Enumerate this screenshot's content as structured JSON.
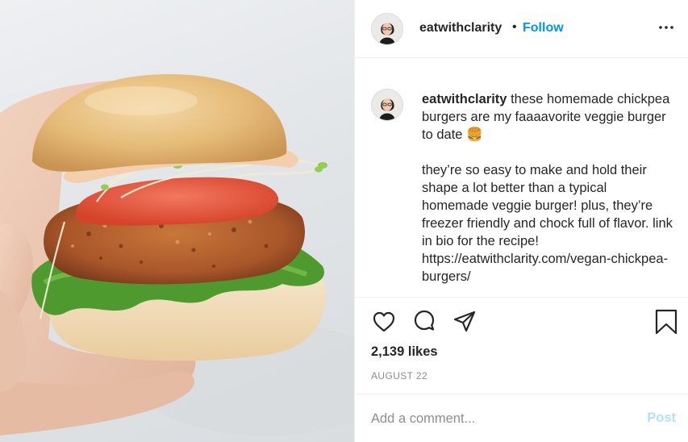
{
  "post": {
    "image": {
      "subject": "burger-photo"
    },
    "header": {
      "username": "eatwithclarity",
      "separator": "•",
      "follow_label": "Follow",
      "more_icon": "more-options-icon"
    },
    "caption": {
      "username": "eatwithclarity",
      "text_line1": "these homemade chickpea burgers are my faaaavorite veggie burger to date 🍔",
      "text_line2": "they’re so easy to make and hold their shape a lot better than a typical homemade veggie burger! plus, they’re freezer friendly and chock full of flavor. link in bio for the recipe! https://eatwithclarity.com/vegan-chickpea-burgers/"
    },
    "actions": {
      "like_icon": "heart-icon",
      "comment_icon": "comment-icon",
      "share_icon": "share-icon",
      "save_icon": "bookmark-icon"
    },
    "likes": "2,139 likes",
    "date": "AUGUST 22",
    "comment_box": {
      "placeholder": "Add a comment...",
      "post_label": "Post"
    },
    "colors": {
      "link_blue": "#0095f6",
      "post_disabled": "#b2dffc",
      "text": "#262626",
      "muted": "#8e8e8e",
      "divider": "#efefef"
    }
  }
}
